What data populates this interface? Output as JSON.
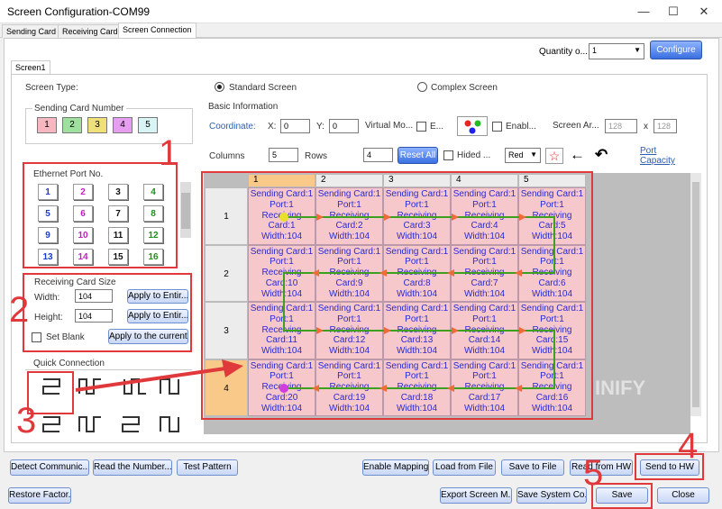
{
  "window": {
    "title": "Screen Configuration-COM99",
    "minimize": "—",
    "maximize": "☐",
    "close": "✕"
  },
  "tabs": [
    "Sending Card",
    "Receiving Card",
    "Screen Connection"
  ],
  "quantity": {
    "label": "Quantity o...",
    "value": "1",
    "configure": "Configure"
  },
  "screen_tab": "Screen1",
  "screen_type": {
    "label": "Screen Type:",
    "standard": "Standard Screen",
    "complex": "Complex Screen"
  },
  "sending_card_number": {
    "title": "Sending Card Number",
    "items": [
      "1",
      "2",
      "3",
      "4",
      "5"
    ],
    "colors": [
      "#f7b7c0",
      "#9fe09f",
      "#f0e07a",
      "#e89ef0",
      "#d8f4f4"
    ]
  },
  "ethernet": {
    "title": "Ethernet Port No.",
    "ports": [
      "1",
      "2",
      "3",
      "4",
      "5",
      "6",
      "7",
      "8",
      "9",
      "10",
      "11",
      "12",
      "13",
      "14",
      "15",
      "16"
    ],
    "colors": [
      "#1c3cc9",
      "#c01cc0",
      "#111",
      "#1c8f1c",
      "#1c3cc9",
      "#c01cc0",
      "#111",
      "#1c8f1c",
      "#1c3cc9",
      "#c01cc0",
      "#111",
      "#1c8f1c",
      "#1c3cc9",
      "#c01cc0",
      "#111",
      "#1c8f1c"
    ]
  },
  "rc_size": {
    "title": "Receiving Card Size",
    "width_label": "Width:",
    "width": "104",
    "height_label": "Height:",
    "height": "104",
    "apply1": "Apply to Entir...",
    "apply2": "Apply to Entir...",
    "set_blank": "Set Blank",
    "apply_current": "Apply to the current."
  },
  "quick": {
    "title": "Quick Connection"
  },
  "basic": {
    "title": "Basic Information",
    "coordinate": "Coordinate:",
    "x_label": "X:",
    "x": "0",
    "y_label": "Y:",
    "y": "0",
    "virtual": "Virtual Mo...",
    "e": "E...",
    "enable": "Enabl...",
    "screen_ar": "Screen Ar...",
    "sw": "128",
    "x_sep": "x",
    "sh": "128",
    "columns_label": "Columns",
    "columns": "5",
    "rows_label": "Rows",
    "rows": "4",
    "reset_all": "Reset All",
    "hided": "Hided ...",
    "color": "Red",
    "port_capacity": "Port Capacity"
  },
  "grid": {
    "col_headers": [
      "1",
      "2",
      "3",
      "4",
      "5"
    ],
    "row_headers": [
      "1",
      "2",
      "3",
      "4"
    ],
    "cells": [
      [
        [
          "Sending Card:1",
          "Port:1",
          "Receiving",
          "Card:1",
          "Width:104"
        ],
        [
          "Sending Card:1",
          "Port:1",
          "Receiving",
          "Card:2",
          "Width:104"
        ],
        [
          "Sending Card:1",
          "Port:1",
          "Receiving",
          "Card:3",
          "Width:104"
        ],
        [
          "Sending Card:1",
          "Port:1",
          "Receiving",
          "Card:4",
          "Width:104"
        ],
        [
          "Sending Card:1",
          "Port:1",
          "Receiving",
          "Card:5",
          "Width:104"
        ]
      ],
      [
        [
          "Sending Card:1",
          "Port:1",
          "Receiving",
          "Card:10",
          "Width:104"
        ],
        [
          "Sending Card:1",
          "Port:1",
          "Receiving",
          "Card:9",
          "Width:104"
        ],
        [
          "Sending Card:1",
          "Port:1",
          "Receiving",
          "Card:8",
          "Width:104"
        ],
        [
          "Sending Card:1",
          "Port:1",
          "Receiving",
          "Card:7",
          "Width:104"
        ],
        [
          "Sending Card:1",
          "Port:1",
          "Receiving",
          "Card:6",
          "Width:104"
        ]
      ],
      [
        [
          "Sending Card:1",
          "Port:1",
          "Receiving",
          "Card:11",
          "Width:104"
        ],
        [
          "Sending Card:1",
          "Port:1",
          "Receiving",
          "Card:12",
          "Width:104"
        ],
        [
          "Sending Card:1",
          "Port:1",
          "Receiving",
          "Card:13",
          "Width:104"
        ],
        [
          "Sending Card:1",
          "Port:1",
          "Receiving",
          "Card:14",
          "Width:104"
        ],
        [
          "Sending Card:1",
          "Port:1",
          "Receiving",
          "Card:15",
          "Width:104"
        ]
      ],
      [
        [
          "Sending Card:1",
          "Port:1",
          "Receiving",
          "Card:20",
          "Width:104"
        ],
        [
          "Sending Card:1",
          "Port:1",
          "Receiving",
          "Card:19",
          "Width:104"
        ],
        [
          "Sending Card:1",
          "Port:1",
          "Receiving",
          "Card:18",
          "Width:104"
        ],
        [
          "Sending Card:1",
          "Port:1",
          "Receiving",
          "Card:17",
          "Width:104"
        ],
        [
          "Sending Card:1",
          "Port:1",
          "Receiving",
          "Card:16",
          "Width:104"
        ]
      ]
    ]
  },
  "watermark": "INIFY",
  "buttons": {
    "detect": "Detect Communic...",
    "read_number": "Read the Number...",
    "test_pattern": "Test Pattern",
    "enable_mapping": "Enable Mapping",
    "load_file": "Load from File",
    "save_file": "Save to File",
    "read_hw": "Read from HW",
    "send_hw": "Send to HW",
    "restore": "Restore Factor...",
    "export": "Export Screen M...",
    "save_system": "Save System Co...",
    "save": "Save",
    "close": "Close"
  },
  "annotations": [
    "1",
    "2",
    "3",
    "4",
    "5"
  ]
}
